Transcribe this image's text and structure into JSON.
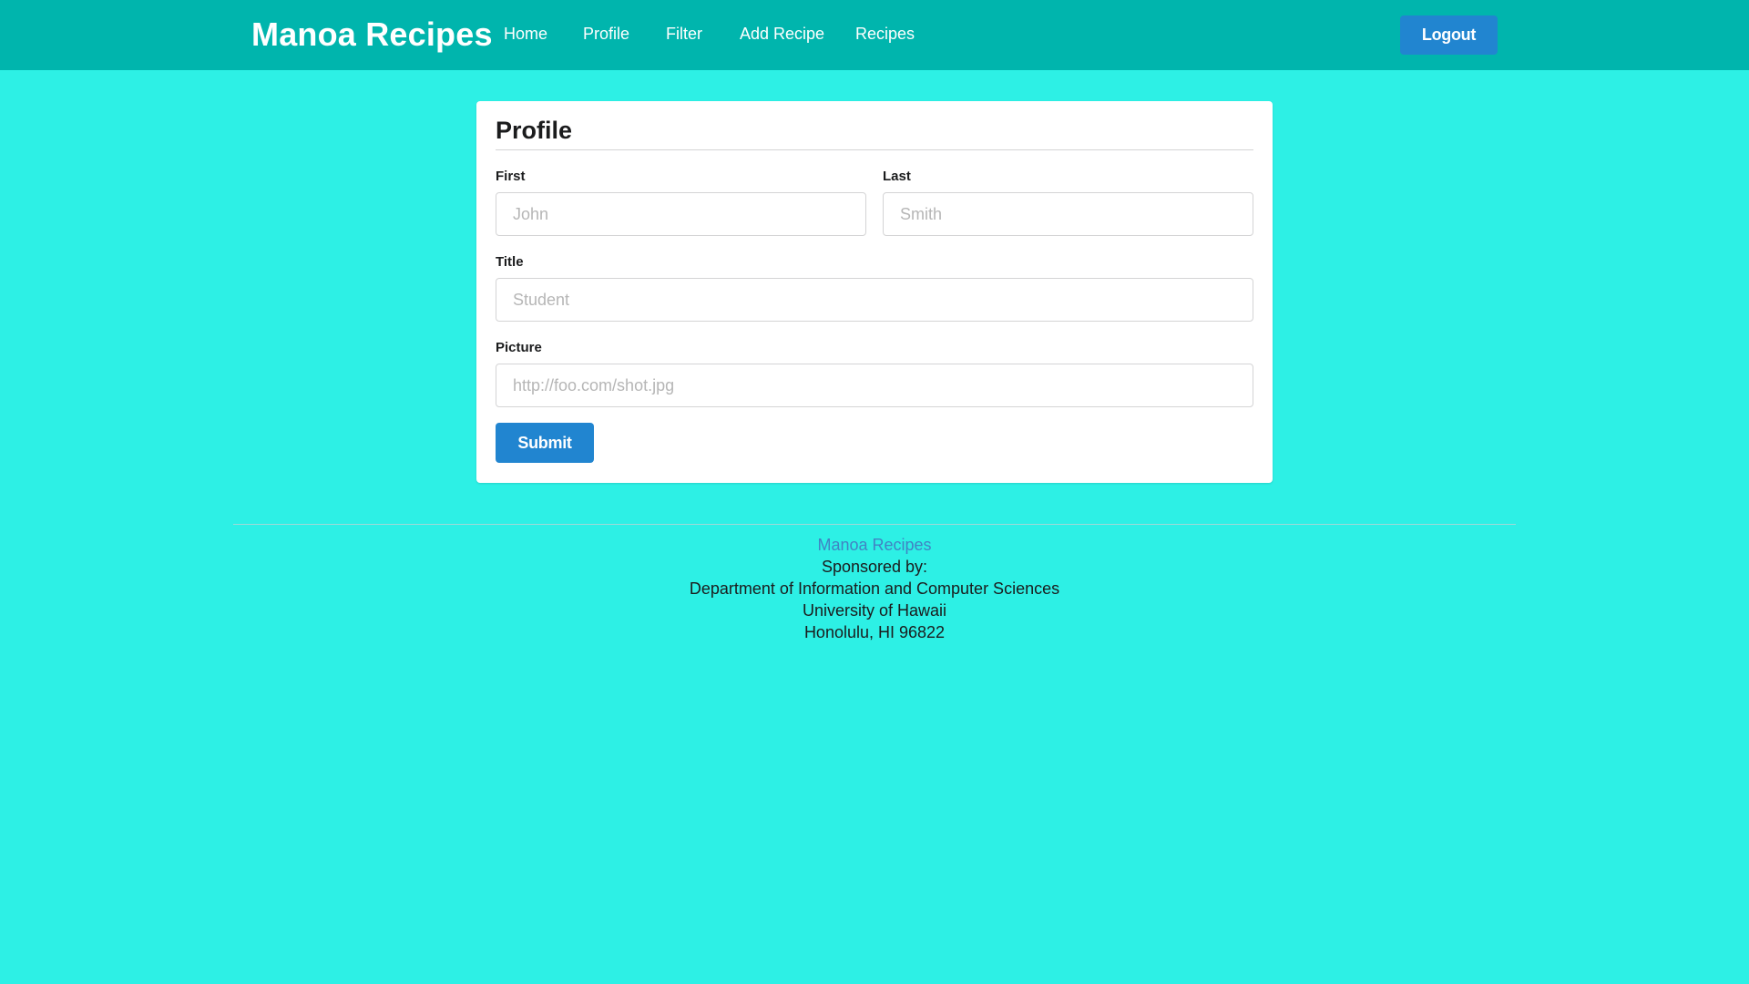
{
  "header": {
    "brand": "Manoa Recipes",
    "nav": [
      "Home",
      "Profile",
      "Filter",
      "Add Recipe",
      "Recipes"
    ],
    "logout_label": "Logout"
  },
  "form": {
    "title": "Profile",
    "first": {
      "label": "First",
      "placeholder": "John",
      "value": ""
    },
    "last": {
      "label": "Last",
      "placeholder": "Smith",
      "value": ""
    },
    "job_title": {
      "label": "Title",
      "placeholder": "Student",
      "value": ""
    },
    "picture": {
      "label": "Picture",
      "placeholder": "http://foo.com/shot.jpg",
      "value": ""
    },
    "submit_label": "Submit"
  },
  "footer": {
    "link": "Manoa Recipes",
    "sponsored": "Sponsored by:",
    "department": "Department of Information and Computer Sciences",
    "university": "University of Hawaii",
    "address": "Honolulu, HI 96822"
  },
  "colors": {
    "page_background": "#2df0e5",
    "header_background": "#00b5ad",
    "primary_button": "#2185d0",
    "link": "#4183c4"
  }
}
